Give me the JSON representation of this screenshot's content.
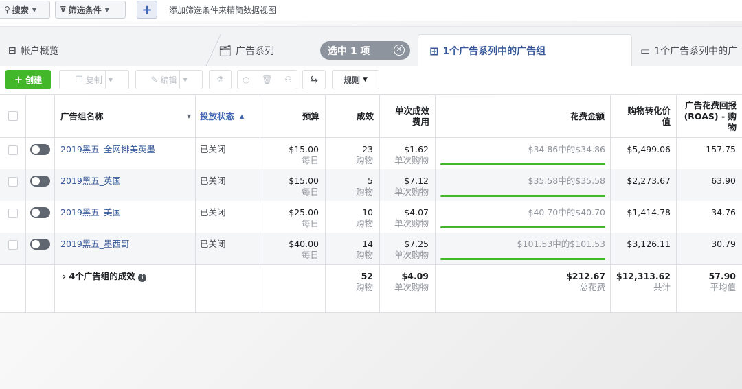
{
  "filter_bar": {
    "search_label": "搜索",
    "filter_label": "筛选条件",
    "add_label": "+",
    "hint": "添加筛选条件来精简数据视图"
  },
  "tabs": {
    "overview": "帐户概览",
    "campaigns": "广告系列",
    "selected_pill": "选中 1 项",
    "adsets": "1个广告系列中的广告组",
    "ads": "1个广告系列中的广"
  },
  "toolbar": {
    "create": "创建",
    "copy": "复制",
    "edit": "编辑",
    "rules": "规则"
  },
  "table": {
    "headers": {
      "name": "广告组名称",
      "status": "投放状态",
      "budget": "预算",
      "results": "成效",
      "cost_per": "单次成效费用",
      "spend": "花费金额",
      "purchase_value": "购物转化价值",
      "roas": "广告花费回报 (ROAS) - 购物"
    },
    "rows": [
      {
        "name": "2019黑五_全网排美英墨",
        "status": "已关闭",
        "budget": "$15.00",
        "budget_sub": "每日",
        "results": "23",
        "results_sub": "购物",
        "cost": "$1.62",
        "cost_sub": "单次购物",
        "spend": "$34.86中的$34.86",
        "spend_fill": 1.0,
        "value": "$5,499.06",
        "roas": "157.75"
      },
      {
        "name": "2019黑五_英国",
        "status": "已关闭",
        "budget": "$15.00",
        "budget_sub": "每日",
        "results": "5",
        "results_sub": "购物",
        "cost": "$7.12",
        "cost_sub": "单次购物",
        "spend": "$35.58中的$35.58",
        "spend_fill": 1.0,
        "value": "$2,273.67",
        "roas": "63.90"
      },
      {
        "name": "2019黑五_美国",
        "status": "已关闭",
        "budget": "$25.00",
        "budget_sub": "每日",
        "results": "10",
        "results_sub": "购物",
        "cost": "$4.07",
        "cost_sub": "单次购物",
        "spend": "$40.70中的$40.70",
        "spend_fill": 1.0,
        "value": "$1,414.78",
        "roas": "34.76"
      },
      {
        "name": "2019黑五_墨西哥",
        "status": "已关闭",
        "budget": "$40.00",
        "budget_sub": "每日",
        "results": "14",
        "results_sub": "购物",
        "cost": "$7.25",
        "cost_sub": "单次购物",
        "spend": "$101.53中的$101.53",
        "spend_fill": 1.0,
        "value": "$3,126.11",
        "roas": "30.79"
      }
    ],
    "summary": {
      "label": "4个广告组的成效",
      "results": "52",
      "results_sub": "购物",
      "cost": "$4.09",
      "cost_sub": "单次购物",
      "spend": "$212.67",
      "spend_sub": "总花费",
      "value": "$12,313.62",
      "value_sub": "共计",
      "roas": "57.90",
      "roas_sub": "平均值"
    }
  },
  "colors": {
    "accent": "#4267b2",
    "link": "#365899",
    "create_green": "#42b72a"
  }
}
